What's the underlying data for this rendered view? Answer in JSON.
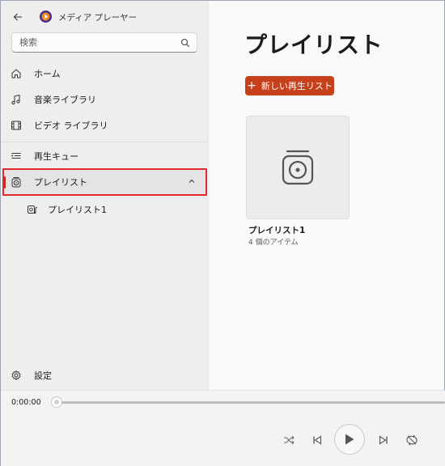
{
  "app": {
    "title": "メディア プレーヤー",
    "accent_color": "#c6401c"
  },
  "search": {
    "placeholder": "検索",
    "value": ""
  },
  "sidebar": {
    "items": [
      {
        "label": "ホーム",
        "icon": "home-icon"
      },
      {
        "label": "音楽ライブラリ",
        "icon": "music-note-icon"
      },
      {
        "label": "ビデオ ライブラリ",
        "icon": "film-icon"
      },
      {
        "label": "再生キュー",
        "icon": "queue-icon"
      },
      {
        "label": "プレイリスト",
        "icon": "playlist-icon",
        "selected": true,
        "expanded": true
      }
    ],
    "sub_items": [
      {
        "label": "プレイリスト1",
        "icon": "playlist-music-icon"
      }
    ],
    "settings_label": "設定"
  },
  "main": {
    "title": "プレイリスト",
    "new_button_label": "新しい再生リスト",
    "playlists": [
      {
        "name": "プレイリスト1",
        "count_text": "4 個のアイテム"
      }
    ]
  },
  "player": {
    "current_time": "0:00:00",
    "progress": 0
  }
}
